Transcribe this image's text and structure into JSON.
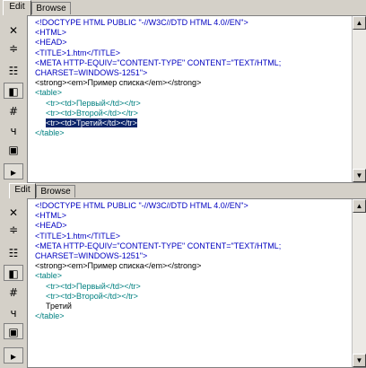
{
  "tabs": [
    "Edit",
    "Browse"
  ],
  "toolbar": {
    "icons": [
      "close-icon",
      "split-icon",
      "list-icon",
      "panel-left-icon",
      "hash-icon",
      "pilcrow-icon",
      "monitor-icon",
      "play-icon"
    ],
    "glyphs": [
      "✕",
      "≑",
      "☷",
      "◧",
      "#",
      "ч",
      "▣",
      "▸"
    ]
  },
  "pane1": {
    "lines": [
      "<!DOCTYPE HTML PUBLIC \"-//W3C//DTD HTML 4.0//EN\">",
      "<HTML>",
      "<HEAD>",
      "<TITLE>1.htm</TITLE>",
      "<META HTTP-EQUIV=\"CONTENT-TYPE\" CONTENT=\"TEXT/HTML;",
      "CHARSET=WINDOWS-1251\">",
      "<strong><em>Пример списка</em></strong>",
      "<table>",
      "<tr><td>Первый</td></tr>",
      "<tr><td>Второй</td></tr>",
      "<tr><td>Третий</td></tr>",
      "</table>"
    ]
  },
  "pane2": {
    "lines": [
      "<!DOCTYPE HTML PUBLIC \"-//W3C//DTD HTML 4.0//EN\">",
      "<HTML>",
      "<HEAD>",
      "<TITLE>1.htm</TITLE>",
      "<META HTTP-EQUIV=\"CONTENT-TYPE\" CONTENT=\"TEXT/HTML;",
      "CHARSET=WINDOWS-1251\">",
      "<strong><em>Пример списка</em></strong>",
      "<table>",
      "<tr><td>Первый</td></tr>",
      "<tr><td>Второй</td></tr>",
      "Третий",
      "</table>"
    ]
  },
  "colors": {
    "tag": "#0000c0",
    "table_tag": "#008080",
    "selection": "#0a246a"
  }
}
